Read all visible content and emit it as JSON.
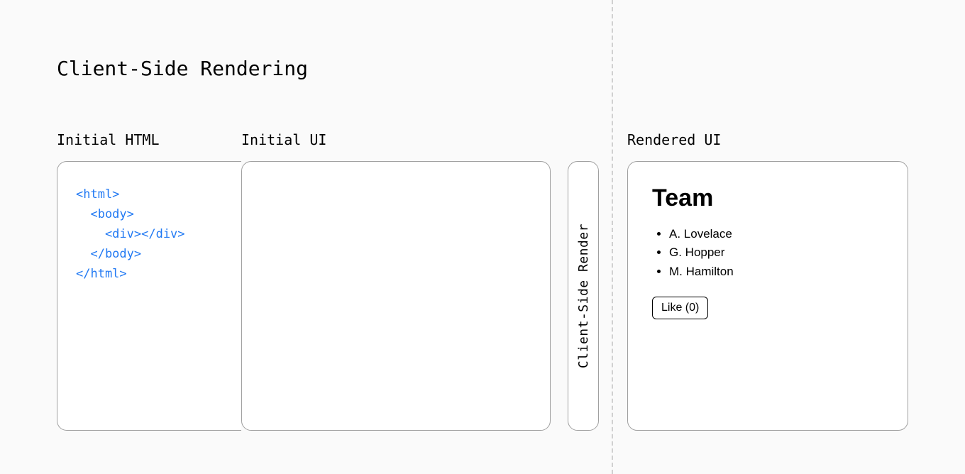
{
  "title": "Client-Side Rendering",
  "columns": {
    "initial_html": {
      "label": "Initial HTML",
      "code": {
        "l0": "<html>",
        "l1": "  <body>",
        "l2": "    <div></div>",
        "l3": "  </body>",
        "l4": "</html>"
      }
    },
    "initial_ui": {
      "label": "Initial UI"
    },
    "render_step": {
      "label": "Client-Side Render"
    },
    "rendered_ui": {
      "label": "Rendered UI",
      "heading": "Team",
      "members": {
        "m0": "A. Lovelace",
        "m1": "G. Hopper",
        "m2": "M. Hamilton"
      },
      "like_button": "Like (0)"
    }
  }
}
